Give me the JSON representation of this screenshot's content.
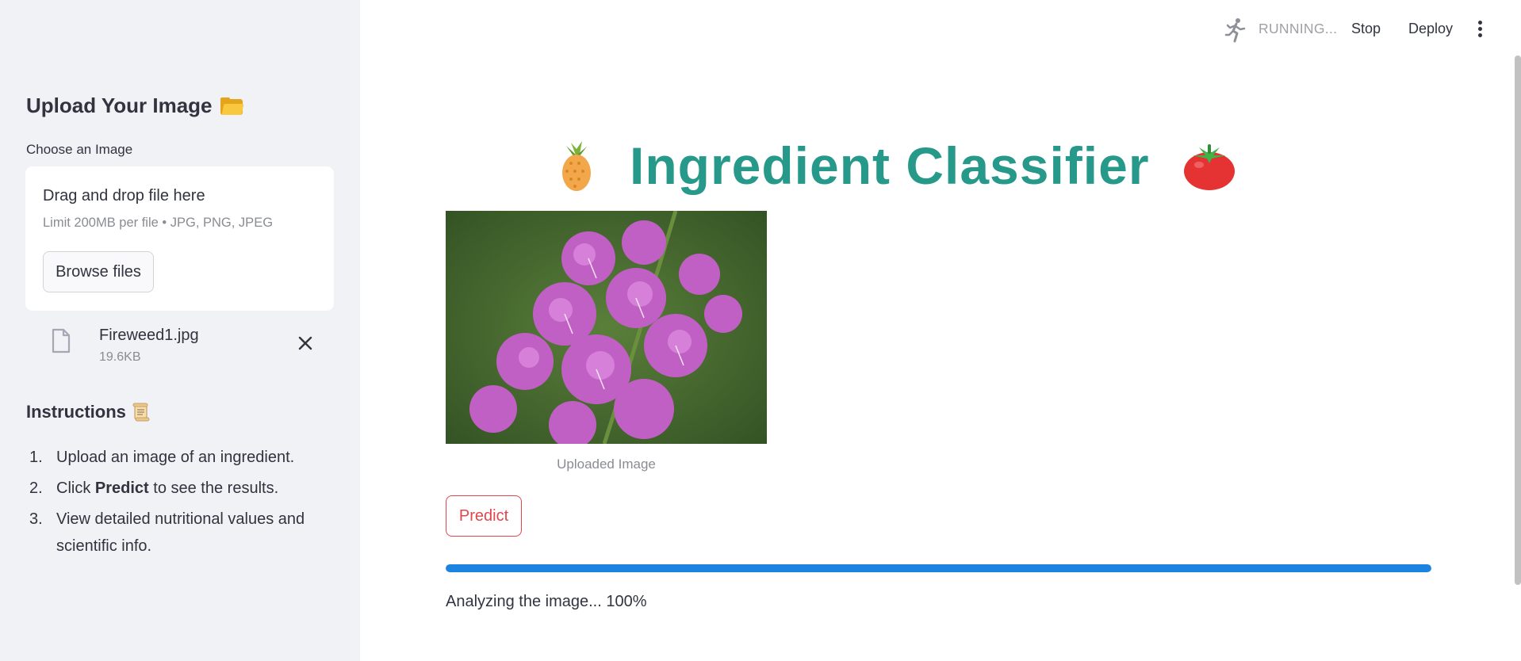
{
  "sidebar": {
    "upload_title": "Upload Your Image",
    "upload_title_emoji": "folder-icon",
    "choose_label": "Choose an Image",
    "dropzone": {
      "title": "Drag and drop file here",
      "limits": "Limit 200MB per file • JPG, PNG, JPEG",
      "browse_label": "Browse files"
    },
    "uploaded_file": {
      "name": "Fireweed1.jpg",
      "size": "19.6KB"
    },
    "instructions_title": "Instructions",
    "instructions_emoji": "scroll-icon",
    "instructions": [
      {
        "num": "1.",
        "before": "Upload an image of an ingredient.",
        "bold": "",
        "after": ""
      },
      {
        "num": "2.",
        "before": "Click ",
        "bold": "Predict",
        "after": " to see the results."
      },
      {
        "num": "3.",
        "before": "View detailed nutritional values and scientific info.",
        "bold": "",
        "after": ""
      }
    ]
  },
  "header": {
    "status": "RUNNING...",
    "stop_label": "Stop",
    "deploy_label": "Deploy"
  },
  "main": {
    "title": "Ingredient Classifier",
    "title_left_emoji": "pineapple-icon",
    "title_right_emoji": "tomato-icon",
    "image_caption": "Uploaded Image",
    "predict_label": "Predict",
    "progress_percent": 100,
    "status_text": "Analyzing the image... 100%"
  },
  "colors": {
    "title": "#26998a",
    "accent_red": "#e0474c",
    "progress": "#1c83e1",
    "sidebar_bg": "#f0f2f6"
  }
}
